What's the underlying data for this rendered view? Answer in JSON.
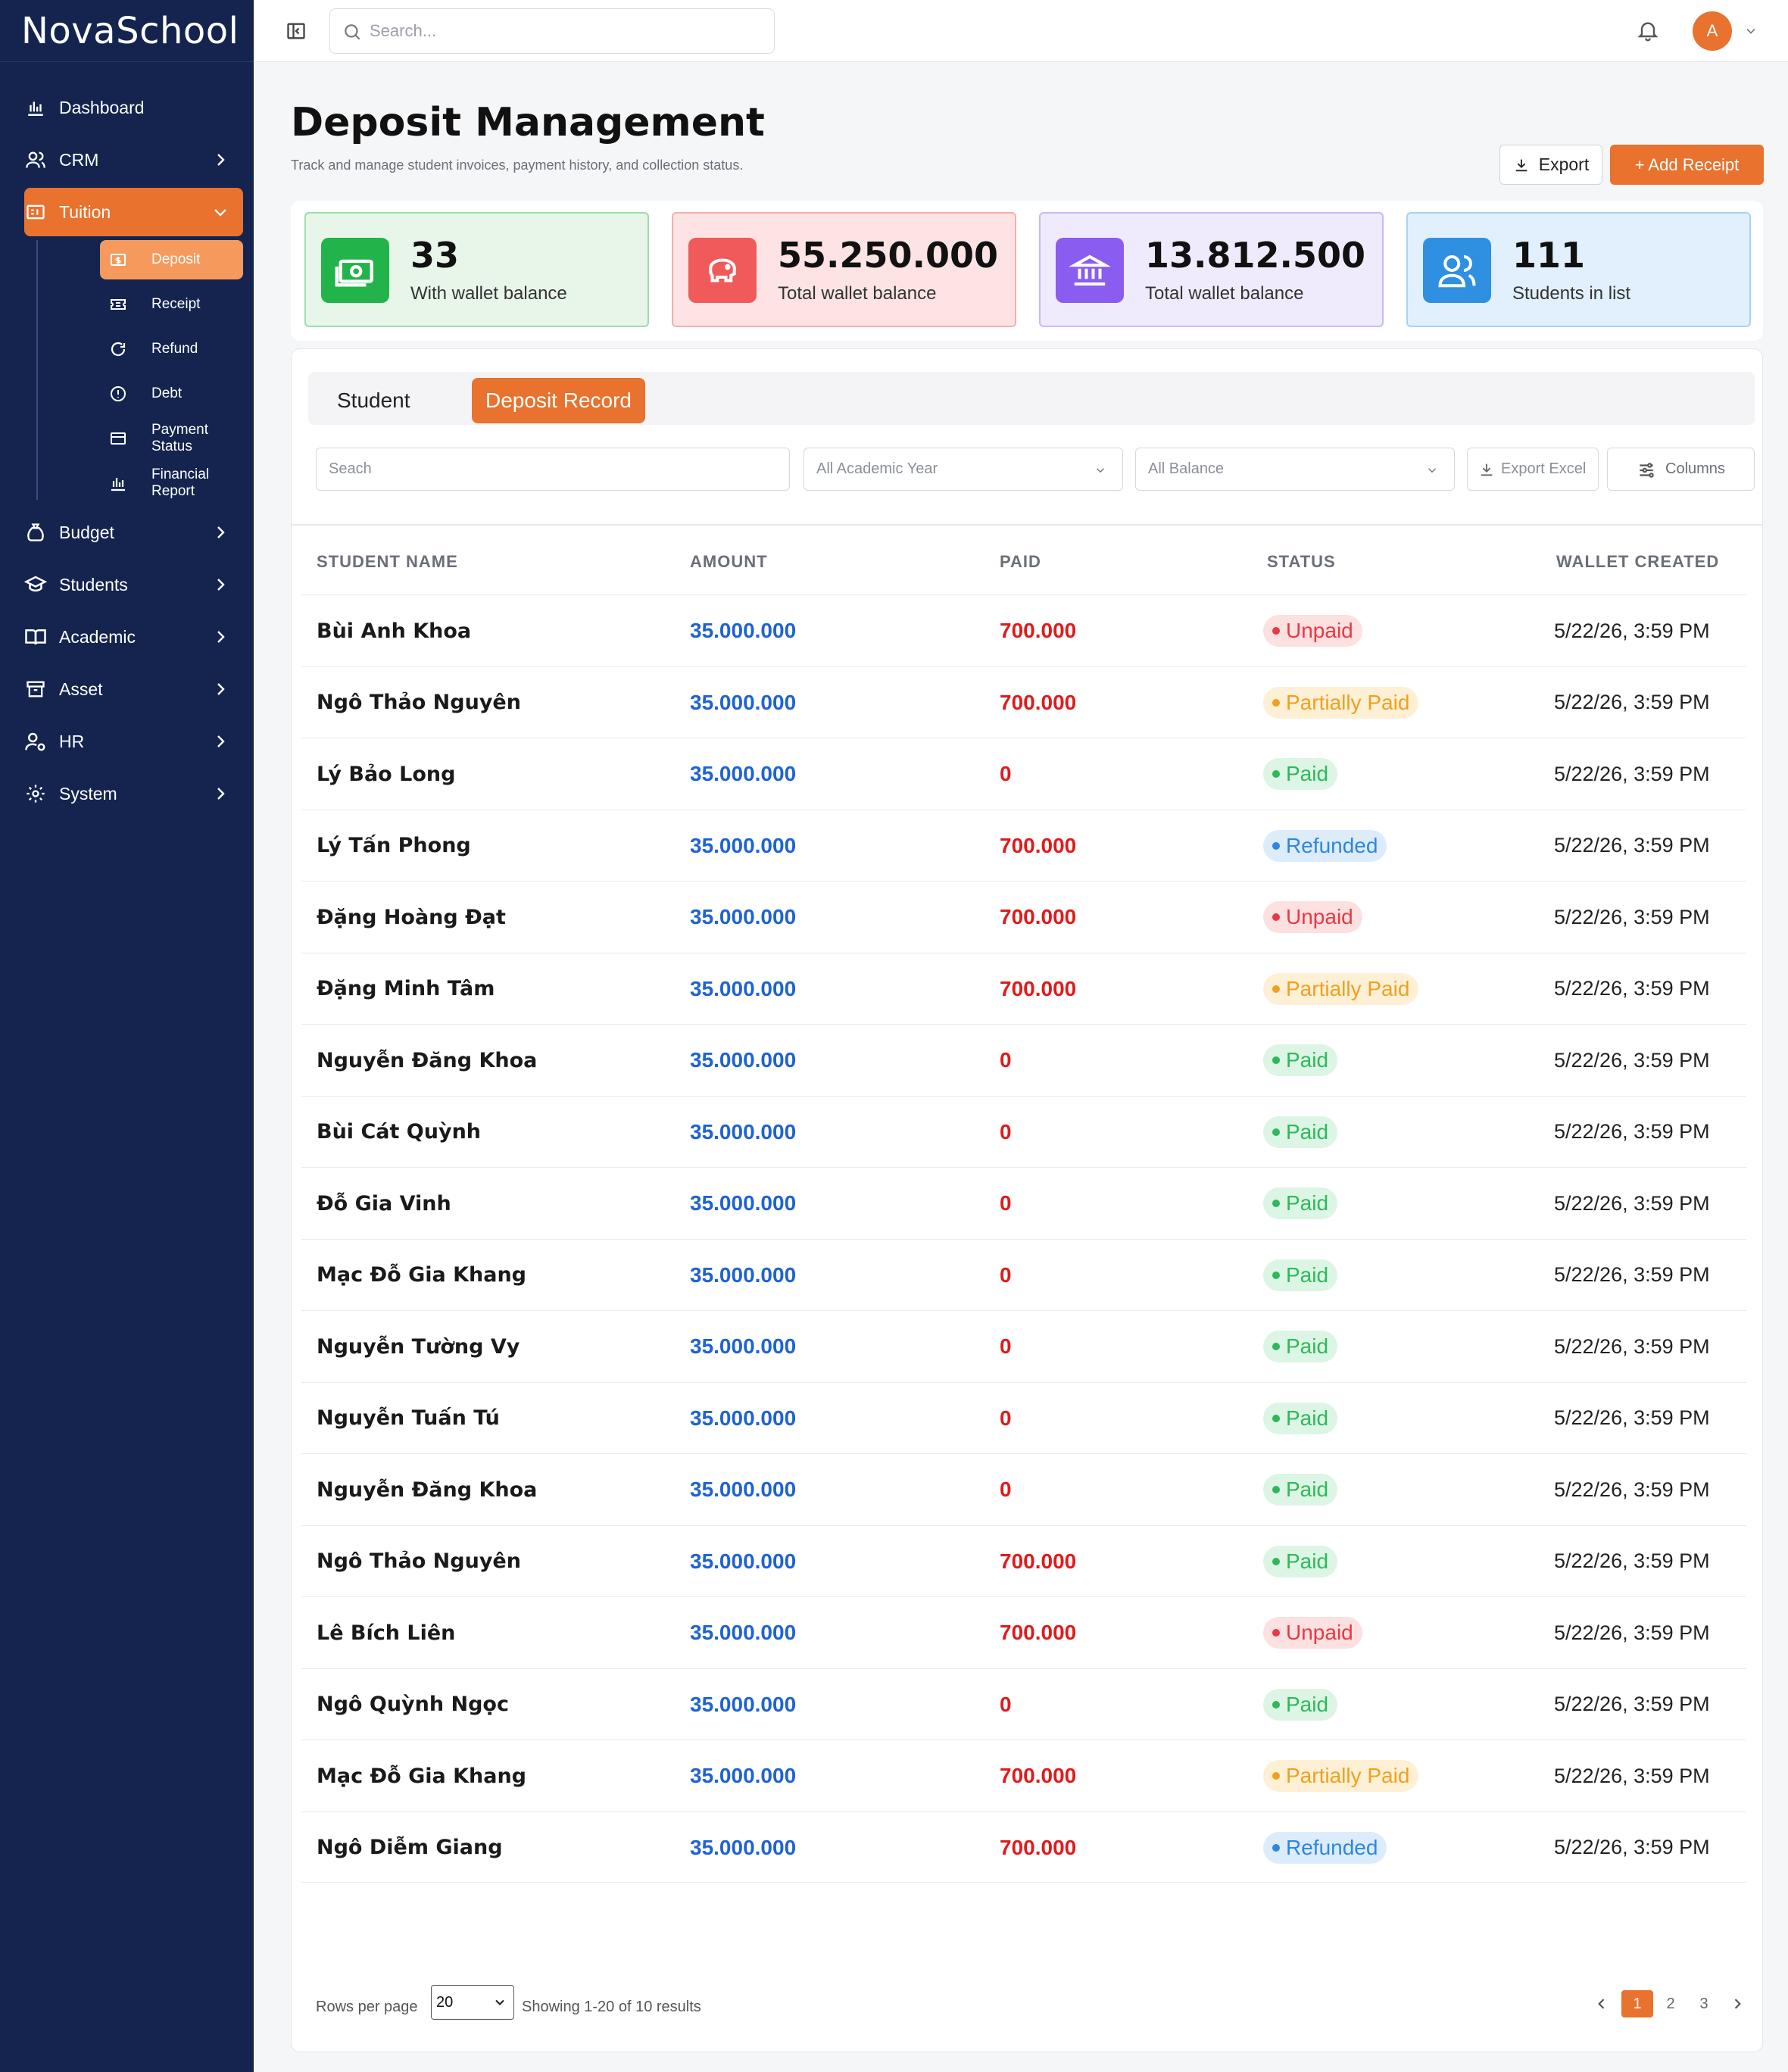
{
  "app": {
    "brand": "NovaSchool"
  },
  "sidebar": {
    "items": [
      {
        "label": "Dashboard",
        "icon": "bar-chart-icon"
      },
      {
        "label": "CRM",
        "icon": "users-icon"
      },
      {
        "label": "Tuition",
        "icon": "tuition-icon"
      },
      {
        "label": "Budget",
        "icon": "money-bag-icon"
      },
      {
        "label": "Students",
        "icon": "graduation-cap-icon"
      },
      {
        "label": "Academic",
        "icon": "book-icon"
      },
      {
        "label": "Asset",
        "icon": "archive-icon"
      },
      {
        "label": "HR",
        "icon": "user-gear-icon"
      },
      {
        "label": "System",
        "icon": "gear-icon"
      }
    ],
    "tuition_sub": [
      {
        "label": "Deposit",
        "icon": "dollar-square-icon"
      },
      {
        "label": "Receipt",
        "icon": "ticket-icon"
      },
      {
        "label": "Refund",
        "icon": "refresh-icon"
      },
      {
        "label": "Debt",
        "icon": "alert-circle-icon"
      },
      {
        "label": "Payment Status",
        "icon": "card-icon"
      },
      {
        "label": "Financial Report",
        "icon": "bar-chart-icon"
      }
    ]
  },
  "topbar": {
    "search_placeholder": "Search...",
    "avatar_letter": "A"
  },
  "page": {
    "title": "Deposit Management",
    "subtitle": "Track and manage student invoices, payment history, and collection status.",
    "export_label": "Export",
    "add_label": "+ Add Receipt"
  },
  "stats": [
    {
      "value": "33",
      "label": "With wallet balance",
      "color": "#22b34a"
    },
    {
      "value": "55.250.000",
      "label": "Total wallet balance",
      "color": "#f05a5a"
    },
    {
      "value": "13.812.500",
      "label": "Total wallet balance",
      "color": "#8a5cf0"
    },
    {
      "value": "111",
      "label": "Students in list",
      "color": "#2f8fe0"
    }
  ],
  "tabs": {
    "student": "Student",
    "deposit_record": "Deposit Record"
  },
  "filters": {
    "search_placeholder": "Seach",
    "year": "All Academic Year",
    "balance": "All Balance",
    "export_excel": "Export Excel",
    "columns": "Columns"
  },
  "table": {
    "headers": {
      "name": "STUDENT NAME",
      "amount": "AMOUNT",
      "paid": "PAID",
      "status": "STATUS",
      "created": "WALLET CREATED"
    },
    "rows": [
      {
        "name": "Bùi Anh Khoa",
        "amount": "35.000.000",
        "paid": "700.000",
        "status": "Unpaid",
        "created": "5/22/26, 3:59 PM"
      },
      {
        "name": "Ngô Thảo Nguyên",
        "amount": "35.000.000",
        "paid": "700.000",
        "status": "Partially Paid",
        "created": "5/22/26, 3:59 PM"
      },
      {
        "name": "Lý Bảo Long",
        "amount": "35.000.000",
        "paid": "0",
        "status": "Paid",
        "created": "5/22/26, 3:59 PM"
      },
      {
        "name": "Lý Tấn Phong",
        "amount": "35.000.000",
        "paid": "700.000",
        "status": "Refunded",
        "created": "5/22/26, 3:59 PM"
      },
      {
        "name": "Đặng Hoàng Đạt",
        "amount": "35.000.000",
        "paid": "700.000",
        "status": "Unpaid",
        "created": "5/22/26, 3:59 PM"
      },
      {
        "name": "Đặng Minh Tâm",
        "amount": "35.000.000",
        "paid": "700.000",
        "status": "Partially Paid",
        "created": "5/22/26, 3:59 PM"
      },
      {
        "name": "Nguyễn Đăng Khoa",
        "amount": "35.000.000",
        "paid": "0",
        "status": "Paid",
        "created": "5/22/26, 3:59 PM"
      },
      {
        "name": "Bùi Cát Quỳnh",
        "amount": "35.000.000",
        "paid": "0",
        "status": "Paid",
        "created": "5/22/26, 3:59 PM"
      },
      {
        "name": "Đỗ Gia Vinh",
        "amount": "35.000.000",
        "paid": "0",
        "status": "Paid",
        "created": "5/22/26, 3:59 PM"
      },
      {
        "name": "Mạc Đỗ Gia Khang",
        "amount": "35.000.000",
        "paid": "0",
        "status": "Paid",
        "created": "5/22/26, 3:59 PM"
      },
      {
        "name": "Nguyễn Tường Vy",
        "amount": "35.000.000",
        "paid": "0",
        "status": "Paid",
        "created": "5/22/26, 3:59 PM"
      },
      {
        "name": "Nguyễn Tuấn Tú",
        "amount": "35.000.000",
        "paid": "0",
        "status": "Paid",
        "created": "5/22/26, 3:59 PM"
      },
      {
        "name": "Nguyễn Đăng Khoa",
        "amount": "35.000.000",
        "paid": "0",
        "status": "Paid",
        "created": "5/22/26, 3:59 PM"
      },
      {
        "name": "Ngô Thảo Nguyên",
        "amount": "35.000.000",
        "paid": "700.000",
        "status": "Paid",
        "created": "5/22/26, 3:59 PM"
      },
      {
        "name": "Lê Bích Liên",
        "amount": "35.000.000",
        "paid": "700.000",
        "status": "Unpaid",
        "created": "5/22/26, 3:59 PM"
      },
      {
        "name": "Ngô Quỳnh Ngọc",
        "amount": "35.000.000",
        "paid": "0",
        "status": "Paid",
        "created": "5/22/26, 3:59 PM"
      },
      {
        "name": "Mạc Đỗ Gia Khang",
        "amount": "35.000.000",
        "paid": "700.000",
        "status": "Partially Paid",
        "created": "5/22/26, 3:59 PM"
      },
      {
        "name": "Ngô Diễm Giang",
        "amount": "35.000.000",
        "paid": "700.000",
        "status": "Refunded",
        "created": "5/22/26, 3:59 PM"
      }
    ]
  },
  "status_colors": {
    "Unpaid": {
      "bg": "#fde0e0",
      "fg": "#e63946",
      "dot": "#e63946"
    },
    "Partially Paid": {
      "bg": "#fdf0d5",
      "fg": "#f0a020",
      "dot": "#f0a020"
    },
    "Paid": {
      "bg": "#dcf5e4",
      "fg": "#2fb85a",
      "dot": "#2fb85a"
    },
    "Refunded": {
      "bg": "#dcecfb",
      "fg": "#2f86e0",
      "dot": "#2f86e0"
    }
  },
  "footer": {
    "rows_per_page_label": "Rows per page",
    "rows_per_page_value": "20",
    "showing": "Showing 1-20 of 10 results",
    "pages": [
      "1",
      "2",
      "3"
    ]
  }
}
